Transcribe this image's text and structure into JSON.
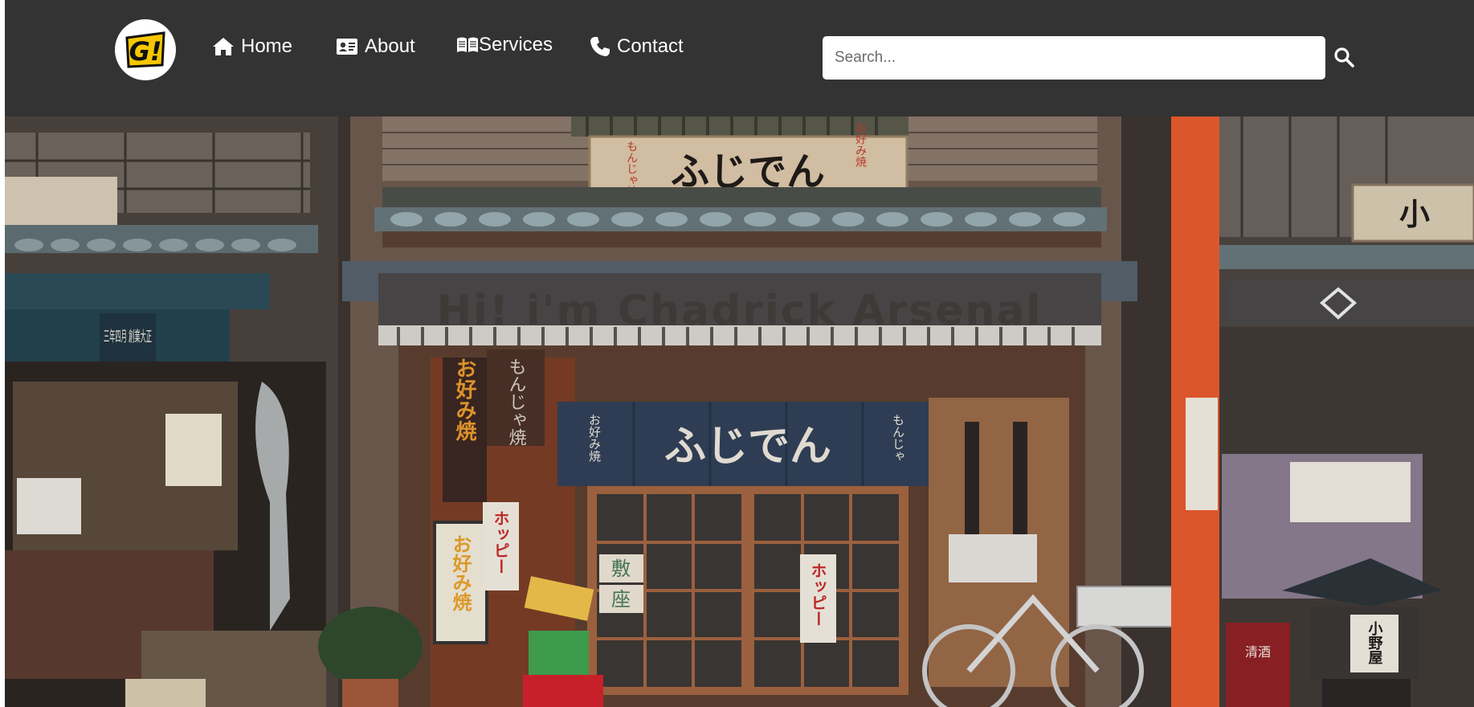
{
  "logo": {
    "text": "G!",
    "icon": "g-logo-icon"
  },
  "nav": {
    "items": [
      {
        "label": "Home",
        "icon": "home-icon"
      },
      {
        "label": "About",
        "icon": "id-card-icon"
      },
      {
        "label": "Services",
        "icon": "open-book-icon"
      },
      {
        "label": "Contact",
        "icon": "phone-icon"
      }
    ]
  },
  "search": {
    "placeholder": "Search...",
    "value": "",
    "icon": "search-icon"
  },
  "hero": {
    "title": "Hi! i'm Chadrick Arsenal",
    "image": "japanese-shopfront-photo",
    "signs": {
      "top_sign": "ふじでん",
      "top_left_vertical": "もんじゃ焼",
      "top_right_vertical": "お好み焼",
      "curtain_main": "ふじでん",
      "curtain_left": "お好み焼",
      "curtain_right": "もんじゃ",
      "pillar_left": "お好み焼",
      "pillar_right": "もんじゃ焼",
      "left_awning": "三年四月 創業大正",
      "lantern": "お好み焼",
      "hoppy_left": "ホッピー",
      "hoppy_right": "ホッピー",
      "menu_1": "敷",
      "menu_2": "座",
      "crate": "清酒",
      "right_lantern": "小野屋",
      "right_sign": "小"
    }
  },
  "colors": {
    "navbar_bg": "#333333",
    "logo_yellow": "#f6c700",
    "pillar_orange": "#e85a2b",
    "curtain_navy": "#2f3f55"
  }
}
